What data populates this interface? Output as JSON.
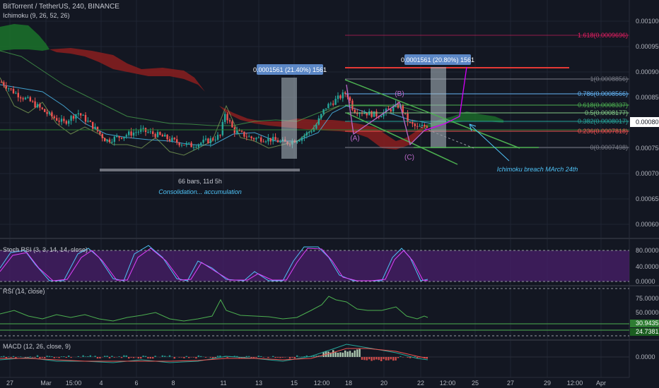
{
  "header": {
    "symbol_line": "BitTorrent / TetherUS, 240, BINANCE",
    "ichimoku_label": "Ichimoku (9, 26, 52, 26)"
  },
  "price_axis": {
    "ticks": [
      "0.0010000",
      "0.0009500",
      "0.0009000",
      "0.0008500",
      "0.0008000",
      "0.0007500",
      "0.0007000",
      "0.0006500",
      "0.0006000"
    ],
    "current_price": "0.0008017",
    "current_price_color": "#131722"
  },
  "time_axis": {
    "ticks": [
      "27",
      "Mar",
      "15:00",
      "4",
      "6",
      "8",
      "11",
      "13",
      "15",
      "12:00",
      "18",
      "20",
      "22",
      "12:00",
      "25",
      "27",
      "29",
      "12:00",
      "Apr"
    ]
  },
  "fib_levels": [
    {
      "label": "1.618(0.0009696)",
      "color": "#e91e63"
    },
    {
      "label": "1(0.0008856)",
      "color": "#787b86"
    },
    {
      "label": "0.786(0.0008566)",
      "color": "#64b5f6"
    },
    {
      "label": "0.618(0.0008337)",
      "color": "#4caf50"
    },
    {
      "label": "0.5(0.0008177)",
      "color": "#81c784"
    },
    {
      "label": "0.382(0.0008017)",
      "color": "#26a69a"
    },
    {
      "label": "0.236(0.0007818)",
      "color": "#ef5350"
    },
    {
      "label": "0(0.0007498)",
      "color": "#787b86"
    }
  ],
  "annotations": {
    "measure_left": "0.0001561 (21.40%) 1561",
    "measure_right": "0.0001561 (20.80%) 1561",
    "bars_label": "66 bars, 11d 5h",
    "consolidation": "Consolidation... accumulation",
    "ichimoku_breach": "Ichimoku breach MArch 24th",
    "wave_a": "(A)",
    "wave_b": "(B)",
    "wave_c": "(C)"
  },
  "stoch": {
    "label": "Stoch RSI (3, 3, 14, 14, close)",
    "ticks": [
      "80.0000",
      "40.0000",
      "0.0000"
    ]
  },
  "rsi": {
    "label": "RSI (14, close)",
    "ticks": [
      "75.0000",
      "50.0000"
    ],
    "badge_upper": "30.9435",
    "badge_lower": "24.7381"
  },
  "macd": {
    "label": "MACD (12, 26, close, 9)",
    "ticks": [
      "0.0000"
    ]
  },
  "chart_data": {
    "type": "candlestick",
    "title": "BitTorrent / TetherUS, 240, BINANCE",
    "x_ticks": [
      "27",
      "Mar",
      "15:00",
      "4",
      "6",
      "8",
      "11",
      "13",
      "15",
      "12:00",
      "18",
      "20",
      "22",
      "12:00",
      "25",
      "27",
      "29",
      "12:00",
      "Apr"
    ],
    "y_ticks": [
      0.001,
      0.00095,
      0.0009,
      0.00085,
      0.0008,
      0.00075,
      0.0007,
      0.00065,
      0.0006
    ],
    "ylim": [
      0.00057,
      0.00104
    ],
    "last_price": 0.0008017,
    "close_path": [
      {
        "x": 2,
        "y": 0.00088
      },
      {
        "x": 20,
        "y": 0.00086
      },
      {
        "x": 45,
        "y": 0.00084
      },
      {
        "x": 70,
        "y": 0.000815
      },
      {
        "x": 90,
        "y": 0.0008
      },
      {
        "x": 110,
        "y": 0.00082
      },
      {
        "x": 130,
        "y": 0.000795
      },
      {
        "x": 150,
        "y": 0.000765
      },
      {
        "x": 175,
        "y": 0.000775
      },
      {
        "x": 200,
        "y": 0.000785
      },
      {
        "x": 225,
        "y": 0.000775
      },
      {
        "x": 250,
        "y": 0.000762
      },
      {
        "x": 270,
        "y": 0.000755
      },
      {
        "x": 295,
        "y": 0.000765
      },
      {
        "x": 312,
        "y": 0.000775
      },
      {
        "x": 318,
        "y": 0.00082
      },
      {
        "x": 330,
        "y": 0.000785
      },
      {
        "x": 355,
        "y": 0.00077
      },
      {
        "x": 380,
        "y": 0.000768
      },
      {
        "x": 405,
        "y": 0.00076
      },
      {
        "x": 425,
        "y": 0.00077
      },
      {
        "x": 445,
        "y": 0.00079
      },
      {
        "x": 460,
        "y": 0.00083
      },
      {
        "x": 475,
        "y": 0.000845
      },
      {
        "x": 490,
        "y": 0.00086
      },
      {
        "x": 500,
        "y": 0.000825
      },
      {
        "x": 515,
        "y": 0.00082
      },
      {
        "x": 535,
        "y": 0.000815
      },
      {
        "x": 550,
        "y": 0.000825
      },
      {
        "x": 565,
        "y": 0.000835
      },
      {
        "x": 578,
        "y": 0.0008
      },
      {
        "x": 590,
        "y": 0.00079
      },
      {
        "x": 605,
        "y": 0.000795
      }
    ]
  }
}
